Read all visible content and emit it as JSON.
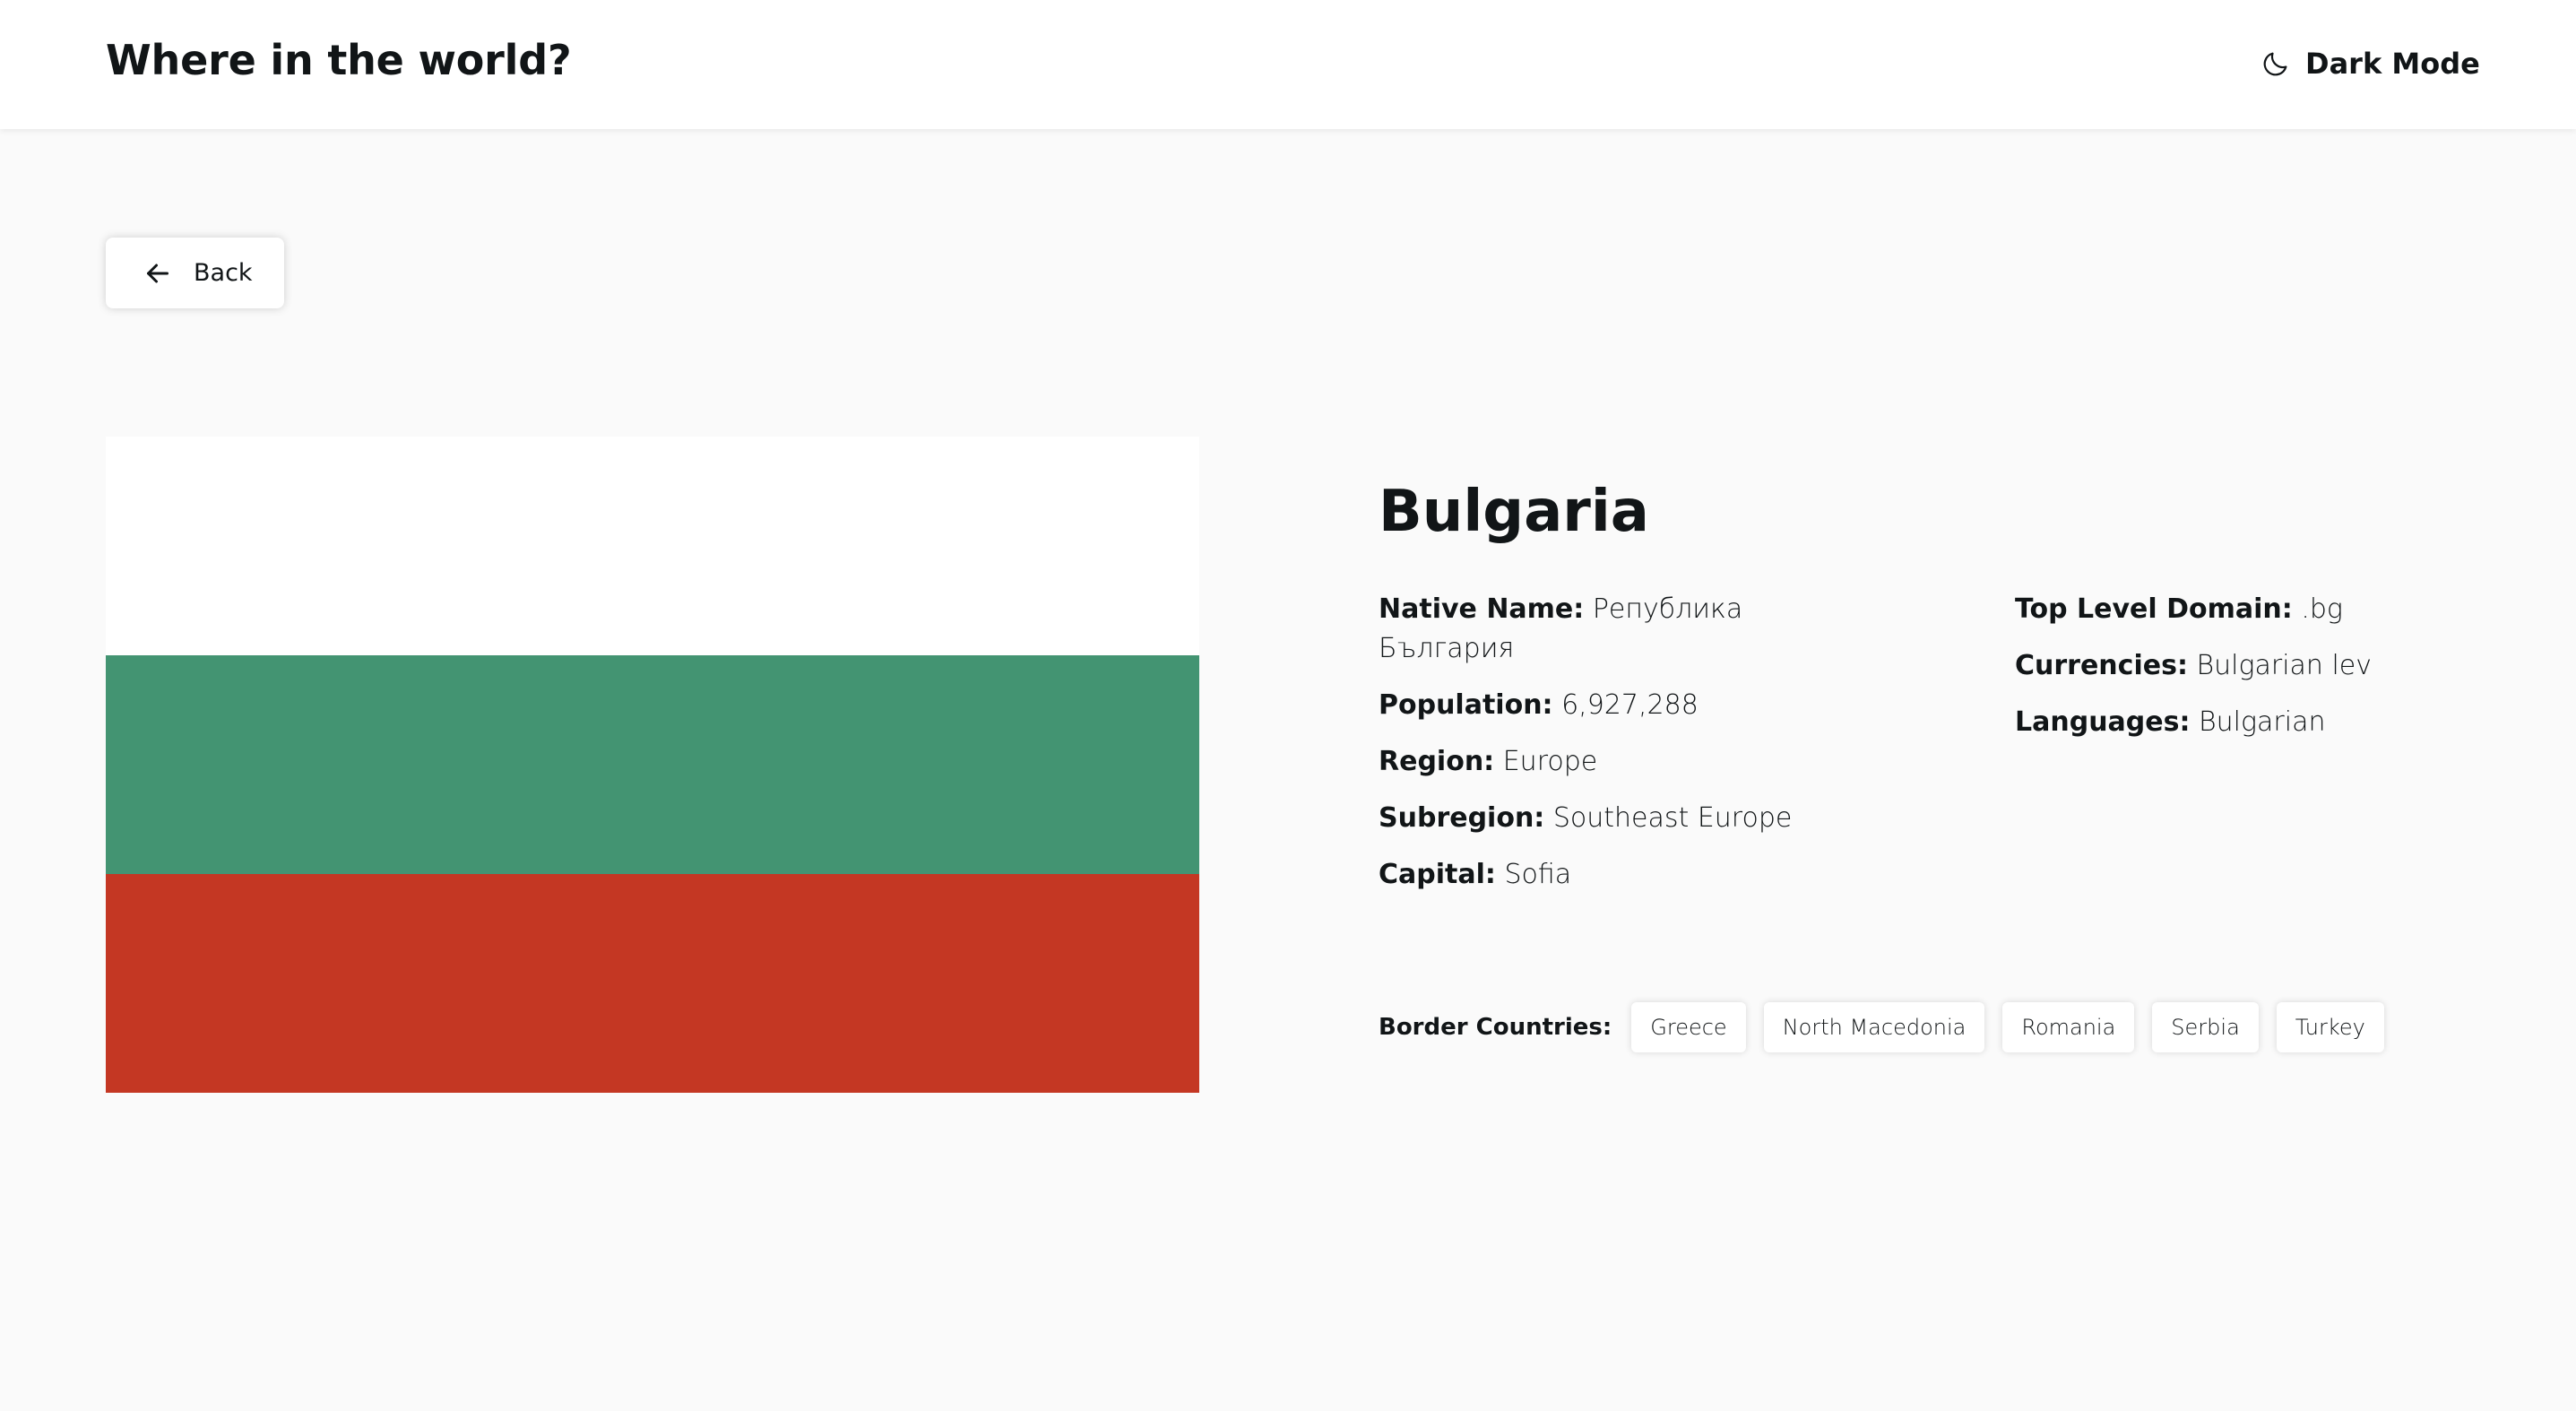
{
  "header": {
    "title": "Where in the world?",
    "theme_toggle_label": "Dark Mode",
    "theme_toggle_icon": "moon-icon"
  },
  "back_button": {
    "label": "Back",
    "icon": "arrow-left-icon"
  },
  "country": {
    "name": "Bulgaria",
    "flag_colors": [
      "#ffffff",
      "#439472",
      "#c43723"
    ],
    "details_left": [
      {
        "key": "native_name",
        "label": "Native Name:",
        "value": "Република България"
      },
      {
        "key": "population",
        "label": "Population:",
        "value": "6,927,288"
      },
      {
        "key": "region",
        "label": "Region:",
        "value": "Europe"
      },
      {
        "key": "subregion",
        "label": "Subregion:",
        "value": "Southeast Europe"
      },
      {
        "key": "capital",
        "label": "Capital:",
        "value": "Sofia"
      }
    ],
    "details_right": [
      {
        "key": "tld",
        "label": "Top Level Domain:",
        "value": ".bg"
      },
      {
        "key": "currencies",
        "label": "Currencies:",
        "value": "Bulgarian lev"
      },
      {
        "key": "languages",
        "label": "Languages:",
        "value": "Bulgarian"
      }
    ],
    "border_countries_label": "Border Countries:",
    "border_countries": [
      "Greece",
      "North Macedonia",
      "Romania",
      "Serbia",
      "Turkey"
    ]
  }
}
